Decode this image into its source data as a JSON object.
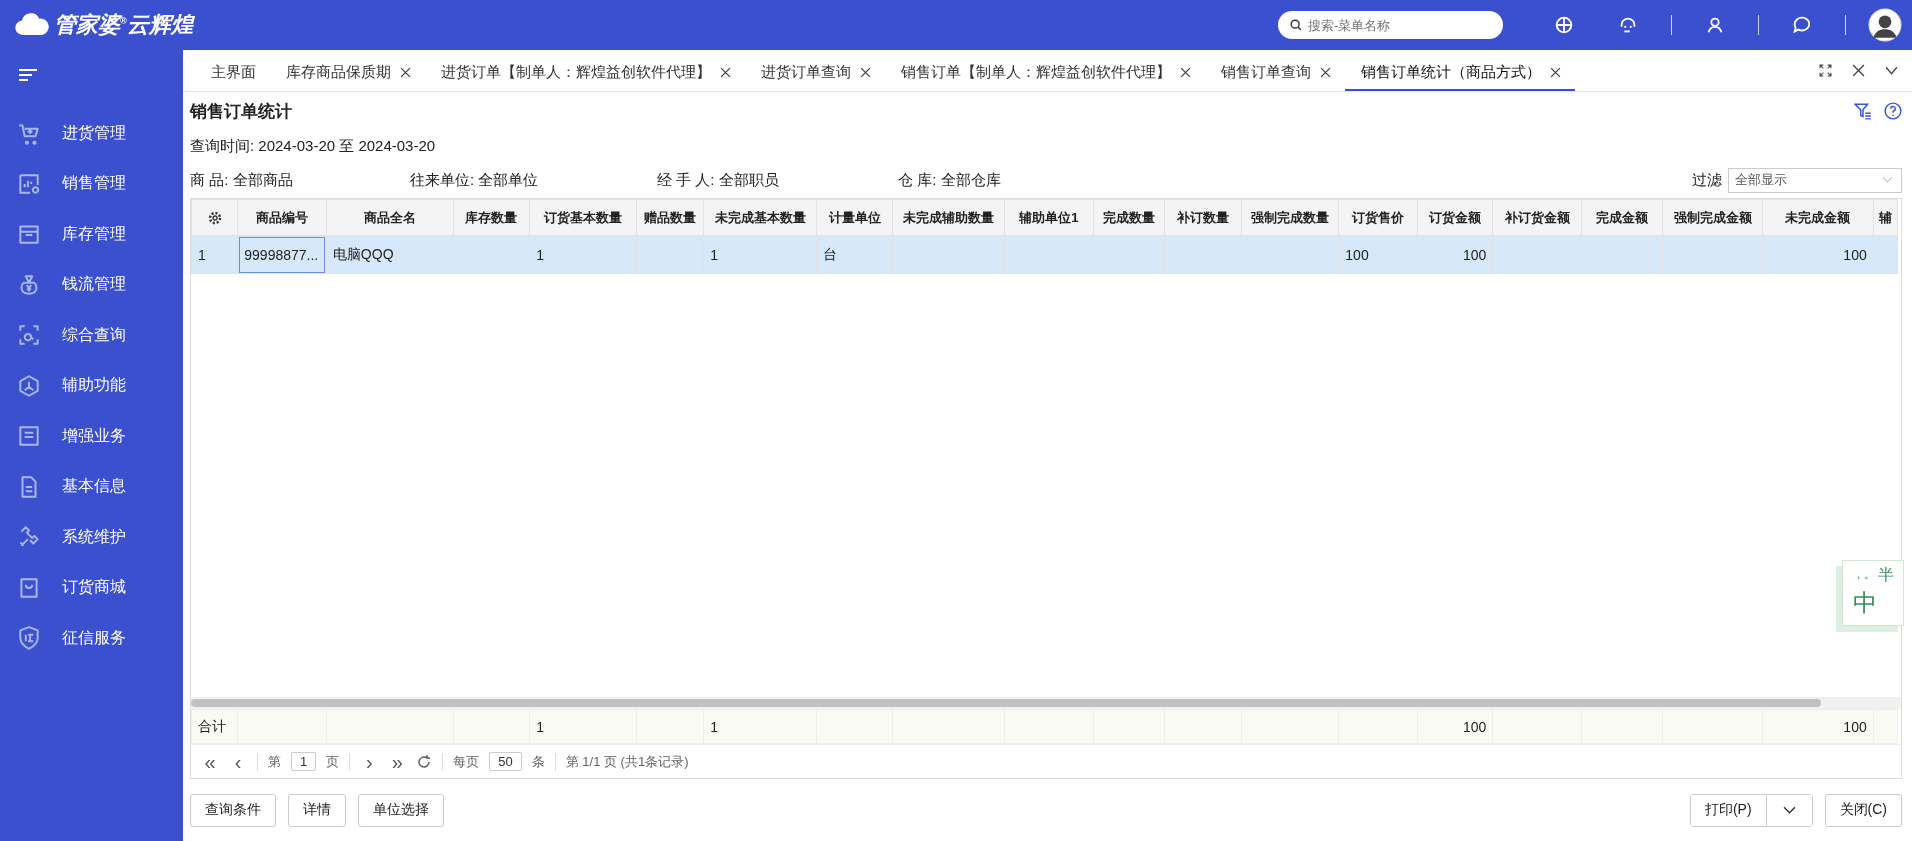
{
  "header": {
    "brand": "管家婆$^{®}$云辉煌",
    "search": {
      "placeholder": "搜索-菜单名称"
    }
  },
  "sidebar": {
    "items": [
      {
        "label": "进货管理",
        "selected": false
      },
      {
        "label": "销售管理",
        "selected": false
      },
      {
        "label": "库存管理",
        "selected": false
      },
      {
        "label": "钱流管理",
        "selected": false
      },
      {
        "label": "综合查询",
        "selected": false
      },
      {
        "label": "辅助功能",
        "selected": false
      },
      {
        "label": "增强业务",
        "selected": false
      },
      {
        "label": "基本信息",
        "selected": false
      },
      {
        "label": "系统维护",
        "selected": false
      },
      {
        "label": "订货商城",
        "selected": false
      },
      {
        "label": "征信服务",
        "selected": false
      }
    ]
  },
  "tabs": [
    {
      "label": "主界面",
      "selected": false,
      "closable": false
    },
    {
      "label": "库存商品保质期",
      "selected": false,
      "closable": true
    },
    {
      "label": "进货订单【制单人：辉煌益创软件代理】",
      "selected": false,
      "closable": true
    },
    {
      "label": "进货订单查询",
      "selected": false,
      "closable": true
    },
    {
      "label": "销售订单【制单人：辉煌益创软件代理】",
      "selected": false,
      "closable": true
    },
    {
      "label": "销售订单查询",
      "selected": false,
      "closable": true
    },
    {
      "label": "销售订单统计（商品方式）",
      "selected": true,
      "closable": true
    }
  ],
  "page_title": "销售订单统计",
  "query_time": "查询时间: 2024-03-20 至 2024-03-20",
  "filters": [
    {
      "label": "商 品:",
      "value": "全部商品"
    },
    {
      "label": "往来单位:",
      "value": "全部单位"
    },
    {
      "label": "经 手 人:",
      "value": "全部职员"
    },
    {
      "label": "仓 库:",
      "value": "全部仓库"
    }
  ],
  "view_filter": {
    "label": "过滤",
    "value": "全部显示"
  },
  "table": {
    "columns": [
      {
        "kind": "gear"
      },
      {
        "label": "商品编号"
      },
      {
        "label": "商品全名"
      },
      {
        "label": "库存数量"
      },
      {
        "label": "订货基本数量"
      },
      {
        "label": "赠品数量"
      },
      {
        "label": "未完成基本数量"
      },
      {
        "label": "计量单位"
      },
      {
        "label": "未完成辅助数量"
      },
      {
        "label": "辅助单位1"
      },
      {
        "label": "完成数量"
      },
      {
        "label": "补订数量"
      },
      {
        "label": "强制完成数量"
      },
      {
        "label": "订货售价"
      },
      {
        "label": "订货金额"
      },
      {
        "label": "补订货金额"
      },
      {
        "label": "完成金额"
      },
      {
        "label": "强制完成金额"
      },
      {
        "label": "未完成金额"
      },
      {
        "label": "辅"
      }
    ],
    "rows": [
      {
        "selected": true,
        "cells": [
          "1",
          "99998877...",
          "电脑QQQ",
          null,
          "1",
          null,
          "1",
          "台",
          null,
          null,
          null,
          null,
          null,
          "100",
          "100",
          null,
          null,
          null,
          "100",
          null
        ]
      }
    ],
    "total_row": {
      "cells": [
        "合计",
        null,
        null,
        null,
        "1",
        null,
        "1",
        null,
        null,
        null,
        null,
        null,
        null,
        null,
        "100",
        null,
        null,
        null,
        "100",
        null
      ]
    }
  },
  "pager": {
    "first": "«",
    "prev": "‹",
    "page_prefix": "第",
    "page": "1",
    "page_suffix": "页",
    "next": "›",
    "last": "»",
    "per_page_prefix": "每页",
    "per_page": "50",
    "per_page_suffix": "条",
    "info": "第 1/1 页 (共1条记录)"
  },
  "buttons_left": [
    "查询条件",
    "详情",
    "单位选择"
  ],
  "print_button": "打印(P)",
  "close_button": "关闭(C)",
  "ime_widget": {
    "punct": "，。",
    "mode": "中",
    "width": "半"
  }
}
